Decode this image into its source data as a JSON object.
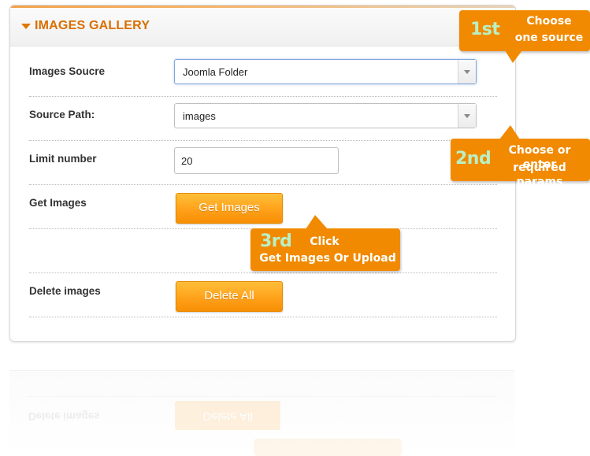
{
  "panel": {
    "title": "IMAGES GALLERY"
  },
  "form": {
    "source": {
      "label": "Images Soucre",
      "value": "Joomla Folder"
    },
    "path": {
      "label": "Source Path:",
      "value": "images"
    },
    "limit": {
      "label": "Limit number",
      "value": "20"
    },
    "get_images": {
      "label": "Get Images",
      "button_label": "Get Images"
    },
    "delete_images": {
      "label": "Delete images",
      "button_label": "Delete All"
    }
  },
  "callouts": {
    "first": {
      "step": "1st",
      "line1": "Choose",
      "line2": "one source"
    },
    "second": {
      "step": "2nd",
      "line1": "Choose or enter",
      "line2": "required params"
    },
    "third": {
      "step": "3rd",
      "line1": "Click",
      "line2": "Get Images Or Upload"
    }
  },
  "reflection": {
    "label": "Delete images",
    "button_label": "Delete All"
  },
  "colors": {
    "accent": "#f18a00",
    "title": "#d86f00",
    "step_number": "#b9f0c5",
    "button_top": "#ffbf3a",
    "button_bottom": "#f78f05"
  },
  "icons": {
    "collapse": "caret-down-icon",
    "dropdown": "chevron-down-icon"
  }
}
